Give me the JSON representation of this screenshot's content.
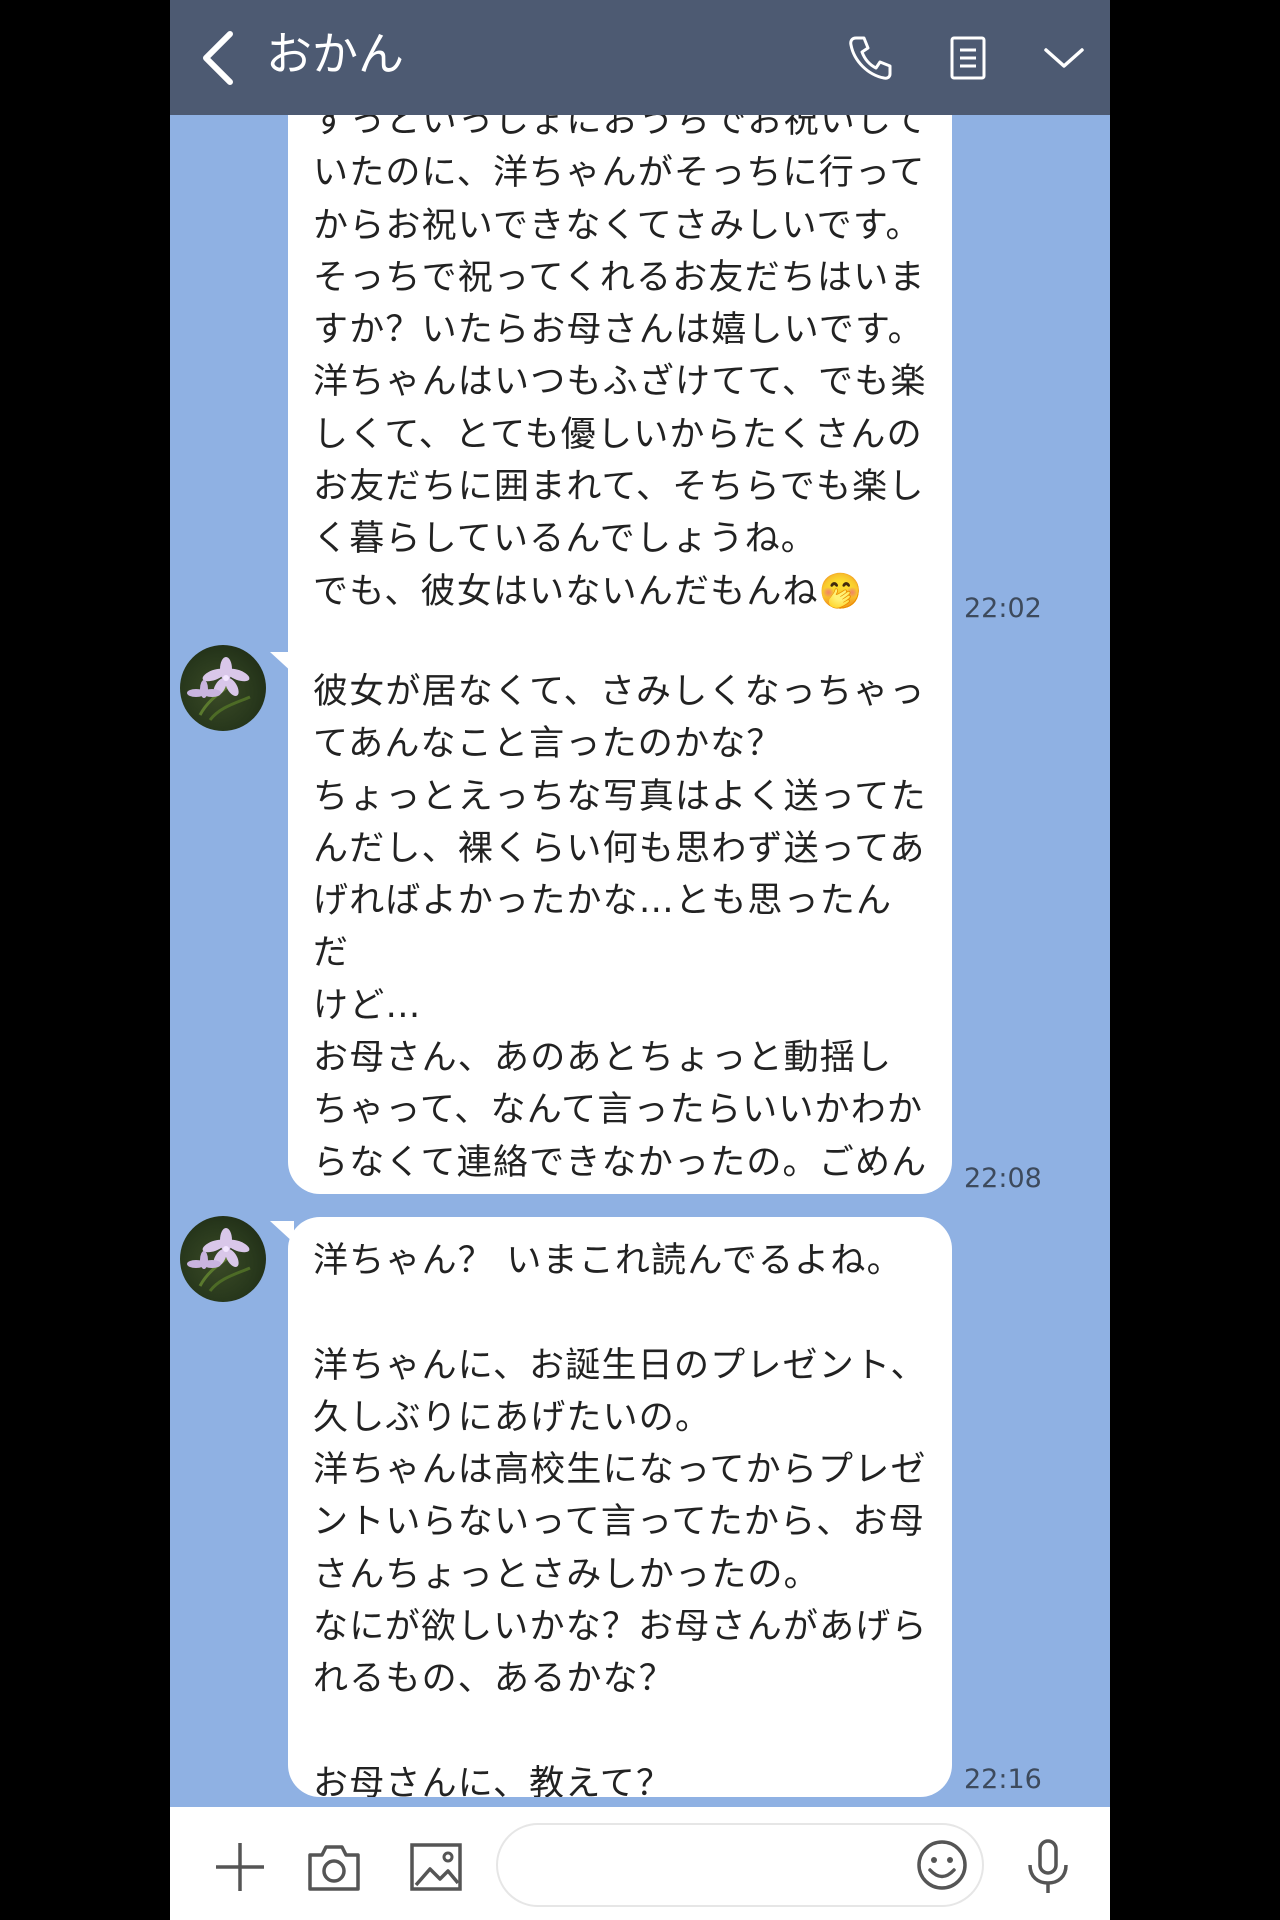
{
  "header": {
    "title": "おかん",
    "back_icon": "chevron-left-icon",
    "call_icon": "phone-icon",
    "notes_icon": "notes-icon",
    "more_icon": "chevron-down-icon",
    "bg_color": "#4d5a72"
  },
  "chat": {
    "bg_color": "#8fb1e3",
    "messages": [
      {
        "text": "ずっといっしょにおうちでお祝いして\nいたのに、洋ちゃんがそっちに行って\nからお祝いできなくてさみしいです。\nそっちで祝ってくれるお友だちはいま\nすか？いたらお母さんは嬉しいです。\n洋ちゃんはいつもふざけてて、でも楽\nしくて、とても優しいからたくさんの\nお友だちに囲まれて、そちらでも楽し\nく暮らしているんでしょうね。\nでも、彼女はいないんだもんね🤭",
        "time": "22:02"
      },
      {
        "text": "彼女が居なくて、さみしくなっちゃっ\nてあんなこと言ったのかな？\nちょっとえっちな写真はよく送ってた\nんだし、裸くらい何も思わず送ってあ\nげればよかったかな…とも思ったんだ\nけど…\nお母さん、あのあとちょっと動揺し\nちゃって、なんて言ったらいいかわか\nらなくて連絡できなかったの。ごめん\nね。",
        "time": "22:08"
      },
      {
        "text": "洋ちゃん？ いまこれ読んでるよね。\n\n洋ちゃんに、お誕生日のプレゼント、\n久しぶりにあげたいの。\n洋ちゃんは高校生になってからプレゼ\nントいらないって言ってたから、お母\nさんちょっとさみしかったの。\nなにが欲しいかな？お母さんがあげら\nれるもの、あるかな？\n\nお母さんに、教えて？",
        "time": "22:16"
      }
    ],
    "avatar_icon": "flower-avatar-icon"
  },
  "input_bar": {
    "plus_icon": "plus-icon",
    "camera_icon": "camera-icon",
    "image_icon": "image-icon",
    "message_value": "",
    "emoji_icon": "smiley-icon",
    "mic_icon": "microphone-icon"
  }
}
